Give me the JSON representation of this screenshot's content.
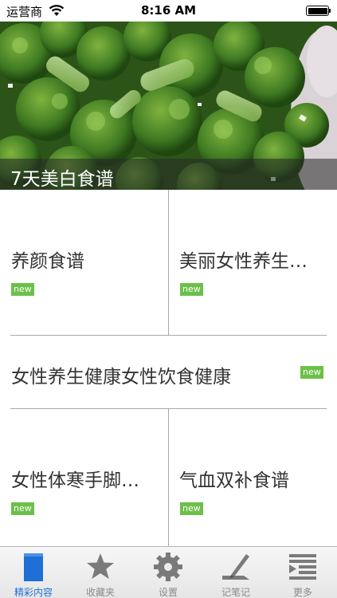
{
  "status_bar": {
    "carrier": "运营商",
    "time": "8:16 AM"
  },
  "hero": {
    "title": "7天美白食谱"
  },
  "grid": {
    "items": [
      {
        "title": "养颜食谱",
        "badge": "new"
      },
      {
        "title": "美丽女性养生…",
        "badge": "new"
      },
      {
        "title": "女性养生健康女性饮食健康",
        "badge": "new"
      },
      {
        "title": "女性体寒手脚…",
        "badge": "new"
      },
      {
        "title": "气血双补食谱",
        "badge": "new"
      }
    ]
  },
  "tab_bar": {
    "tabs": [
      {
        "label": "精彩内容",
        "icon": "featured-icon",
        "active": true
      },
      {
        "label": "收藏夹",
        "icon": "star-icon",
        "active": false
      },
      {
        "label": "设置",
        "icon": "gear-icon",
        "active": false
      },
      {
        "label": "记笔记",
        "icon": "pen-note-icon",
        "active": false
      },
      {
        "label": "更多",
        "icon": "more-list-icon",
        "active": false
      }
    ]
  },
  "colors": {
    "badge": "#6cc04a",
    "active_tab": "#1e6fd6",
    "inactive_tab": "#8a8a8a"
  }
}
